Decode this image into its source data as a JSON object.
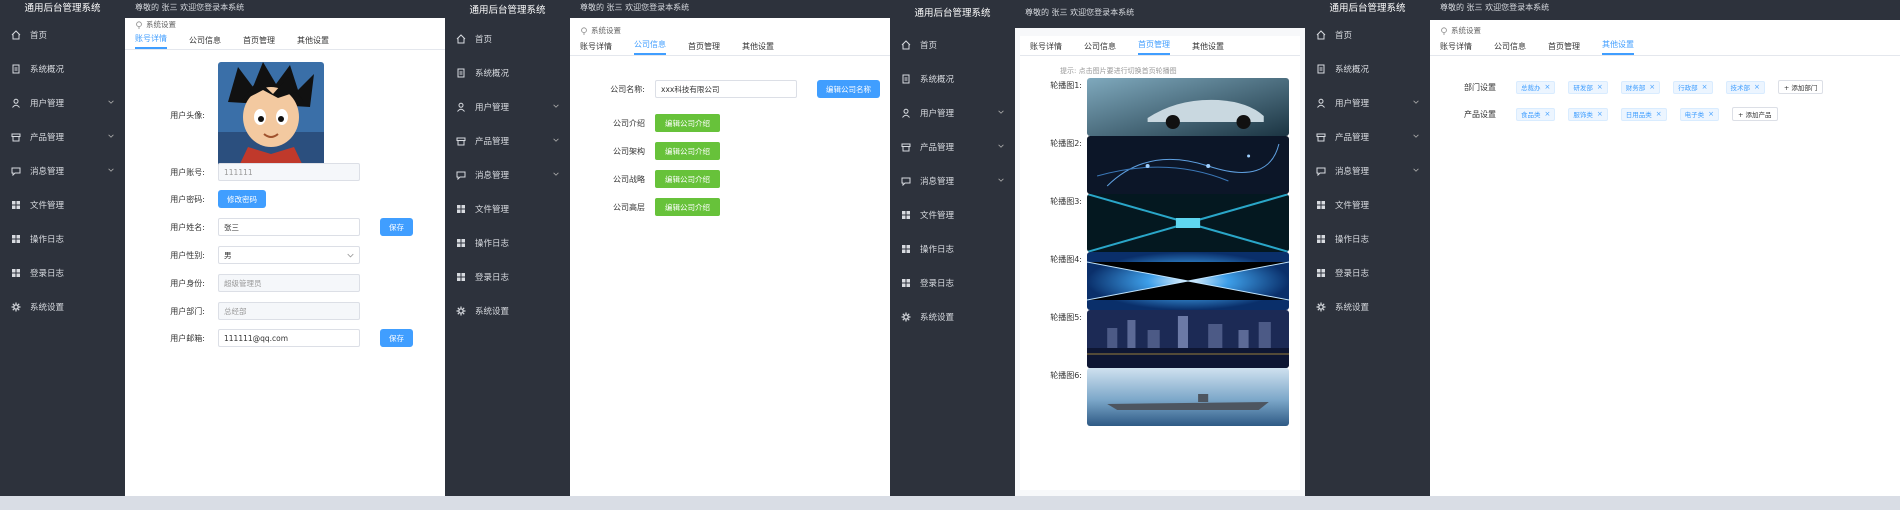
{
  "app": {
    "title": "通用后台管理系统",
    "greeting": "尊敬的 张三 欢迎您登录本系统",
    "breadcrumb": "系统设置"
  },
  "colors": {
    "sidebar": "#2d323c",
    "accent": "#409eff",
    "success": "#67c23a"
  },
  "sidebar": {
    "items": [
      {
        "label": "首页",
        "icon": "home-icon",
        "expandable": false
      },
      {
        "label": "系统概况",
        "icon": "document-icon",
        "expandable": false
      },
      {
        "label": "用户管理",
        "icon": "user-icon",
        "expandable": true
      },
      {
        "label": "产品管理",
        "icon": "box-icon",
        "expandable": true
      },
      {
        "label": "消息管理",
        "icon": "message-icon",
        "expandable": true
      },
      {
        "label": "文件管理",
        "icon": "grid-icon",
        "expandable": false
      },
      {
        "label": "操作日志",
        "icon": "grid-icon",
        "expandable": false
      },
      {
        "label": "登录日志",
        "icon": "grid-icon",
        "expandable": false
      },
      {
        "label": "系统设置",
        "icon": "gear-icon",
        "expandable": false
      }
    ]
  },
  "tabs": [
    "账号详情",
    "公司信息",
    "首页管理",
    "其他设置"
  ],
  "account": {
    "avatar_label": "用户头像:",
    "account_label": "用户账号:",
    "account_value": "111111",
    "password_label": "用户密码:",
    "change_password": "修改密码",
    "name_label": "用户姓名:",
    "name_value": "张三",
    "save": "保存",
    "gender_label": "用户性别:",
    "gender_value": "男",
    "role_label": "用户身份:",
    "role_value": "超级管理员",
    "dept_label": "用户部门:",
    "dept_value": "总经部",
    "email_label": "用户邮箱:",
    "email_value": "111111@qq.com",
    "save2": "保存"
  },
  "company": {
    "name_label": "公司名称:",
    "name_value": "xxx科技有限公司",
    "edit_name": "编辑公司名称",
    "rows": [
      {
        "label": "公司介绍",
        "button": "编辑公司介绍"
      },
      {
        "label": "公司架构",
        "button": "编辑公司介绍"
      },
      {
        "label": "公司战略",
        "button": "编辑公司介绍"
      },
      {
        "label": "公司高层",
        "button": "编辑公司介绍"
      }
    ]
  },
  "homepage": {
    "hint": "提示: 点击图片要进行切换首页轮播图",
    "carousel": [
      {
        "label": "轮播图1:",
        "image": "sports car"
      },
      {
        "label": "轮播图2:",
        "image": "city lights network"
      },
      {
        "label": "轮播图3:",
        "image": "tech tunnel"
      },
      {
        "label": "轮播图4:",
        "image": "blue light tunnel"
      },
      {
        "label": "轮播图5:",
        "image": "city skyline at night"
      },
      {
        "label": "轮播图6:",
        "image": "aircraft carrier"
      }
    ]
  },
  "other": {
    "dept_label": "部门设置",
    "dept_tags": [
      "总裁办",
      "研发部",
      "财务部",
      "行政部",
      "技术部"
    ],
    "add_dept": "+ 添加部门",
    "product_label": "产品设置",
    "product_tags": [
      "食品类",
      "服饰类",
      "日用品类",
      "电子类"
    ],
    "add_product": "+ 添加产品"
  }
}
